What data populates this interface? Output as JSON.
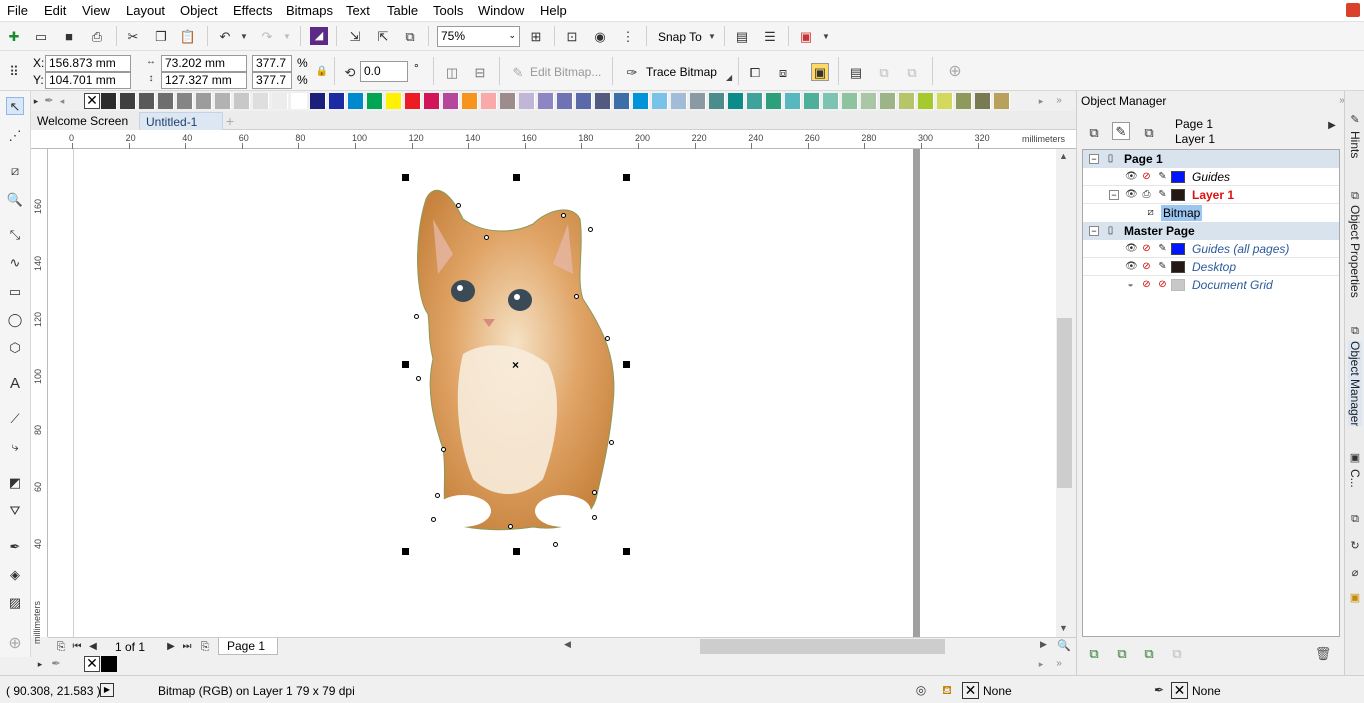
{
  "menu": [
    "File",
    "Edit",
    "View",
    "Layout",
    "Object",
    "Effects",
    "Bitmaps",
    "Text",
    "Table",
    "Tools",
    "Window",
    "Help"
  ],
  "standard_toolbar": {
    "zoom": "75%",
    "snap_to": "Snap To"
  },
  "property_bar": {
    "x_label": "X:",
    "x": "156.873 mm",
    "y_label": "Y:",
    "y": "104.701 mm",
    "width": "73.202 mm",
    "height": "127.327 mm",
    "scale_w": "377.7",
    "scale_h": "377.7",
    "pct": "%",
    "rotation": "0.0",
    "deg": "°",
    "edit_bitmap": "Edit Bitmap...",
    "trace_bitmap": "Trace Bitmap"
  },
  "tabs": [
    "Welcome Screen",
    "Untitled-1"
  ],
  "ruler": {
    "h_ticks": [
      "0",
      "20",
      "40",
      "60",
      "80",
      "100",
      "120",
      "140",
      "160",
      "180",
      "200",
      "220",
      "240",
      "260",
      "280",
      "300",
      "320"
    ],
    "h_unit": "millimeters",
    "v_ticks": [
      "160",
      "140",
      "120",
      "100",
      "80",
      "60",
      "40"
    ],
    "v_unit": "millimeters"
  },
  "palette_colors": [
    "#2b2b2b",
    "#3f3f3f",
    "#595959",
    "#6e6e6e",
    "#858585",
    "#9c9c9c",
    "#b2b2b2",
    "#c8c8c8",
    "#dedede",
    "#ececec",
    "#ffffff",
    "#1b1f7a",
    "#1c2ba4",
    "#0089cf",
    "#00a651",
    "#fff200",
    "#ed1c24",
    "#d2145a",
    "#b5479c",
    "#f7941d",
    "#f9aaa8",
    "#9e8b8b",
    "#c1b6d6",
    "#8e86c4",
    "#6f72b3",
    "#5a6aa8",
    "#525b7f",
    "#3d6ea8",
    "#0095da",
    "#7ac3e8",
    "#a0bcd6",
    "#8a9aa3",
    "#4c8c8c",
    "#0d8b89",
    "#3fa39c",
    "#2e9f7b",
    "#59b7c0",
    "#4eaf9b",
    "#7cc4b1",
    "#8dc39d",
    "#a9c6a5",
    "#9cb488",
    "#b7c56a",
    "#a6ca2e",
    "#d3d95a",
    "#8e9a5c",
    "#7a7a52",
    "#b8a15a"
  ],
  "page_nav": {
    "counter": "1 of 1",
    "page_tab": "Page 1"
  },
  "status": {
    "coords": "( 90.308, 21.583 )",
    "info": "Bitmap (RGB) on Layer 1 79 x 79 dpi",
    "fill": "None",
    "outline": "None"
  },
  "docker": {
    "title": "Object Manager",
    "page": "Page 1",
    "layer": "Layer 1",
    "tree": {
      "page1": "Page 1",
      "guides": "Guides",
      "layer1": "Layer 1",
      "bitmap": "Bitmap",
      "master": "Master Page",
      "guides_all": "Guides (all pages)",
      "desktop": "Desktop",
      "doc_grid": "Document Grid"
    }
  },
  "side_tabs": [
    "Hints",
    "Object Properties",
    "Object Manager",
    "C..."
  ]
}
